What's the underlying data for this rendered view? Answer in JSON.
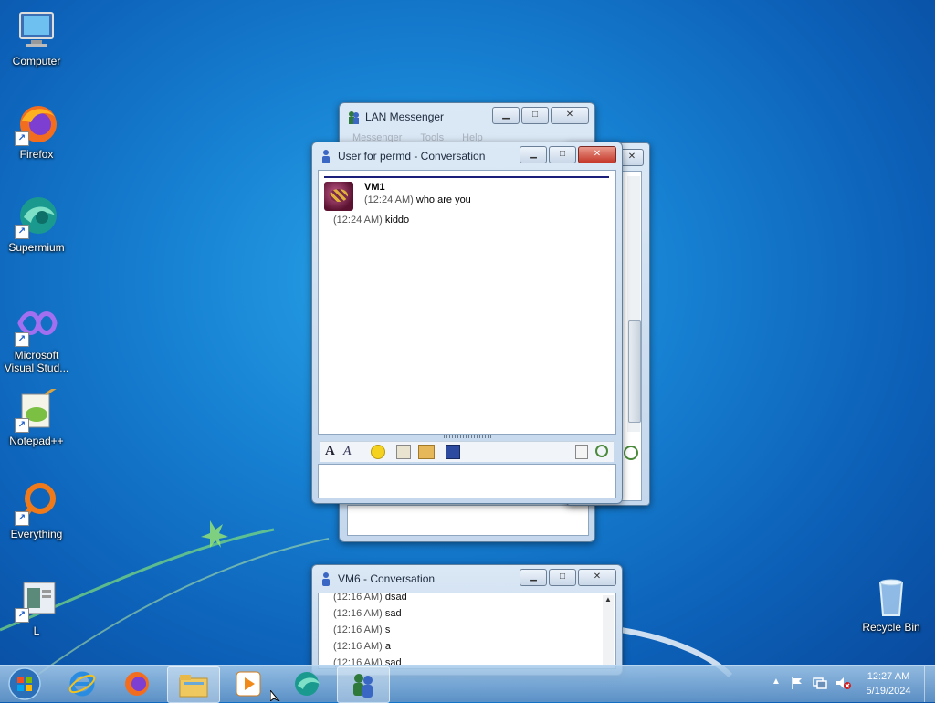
{
  "desktop": {
    "icons": [
      {
        "label": "Computer"
      },
      {
        "label": "Firefox"
      },
      {
        "label": "Supermium"
      },
      {
        "label": "Microsoft Visual Stud..."
      },
      {
        "label": "Notepad++"
      },
      {
        "label": "Everything"
      },
      {
        "label": "L"
      },
      {
        "label": "Recycle Bin"
      }
    ]
  },
  "lan_messenger": {
    "title": "LAN Messenger",
    "menu": [
      "Messenger",
      "Tools",
      "Help"
    ]
  },
  "conversation_main": {
    "title": "User for permd - Conversation",
    "sender": "VM1",
    "messages": [
      {
        "time": "(12:24 AM)",
        "text": "who are you"
      },
      {
        "time": "(12:24 AM)",
        "text": "kiddo"
      }
    ],
    "input_value": ""
  },
  "conversation_vm6": {
    "title": "VM6 - Conversation",
    "messages": [
      {
        "time": "(12:16 AM)",
        "text": "dsad"
      },
      {
        "time": "(12:16 AM)",
        "text": "sad"
      },
      {
        "time": "(12:16 AM)",
        "text": "s"
      },
      {
        "time": "(12:16 AM)",
        "text": "a"
      },
      {
        "time": "(12:16 AM)",
        "text": "sad"
      }
    ]
  },
  "taskbar": {
    "clock_time": "12:27 AM",
    "clock_date": "5/19/2024"
  },
  "colors": {
    "accent": "#1c3fa0",
    "close": "#c5382a"
  }
}
